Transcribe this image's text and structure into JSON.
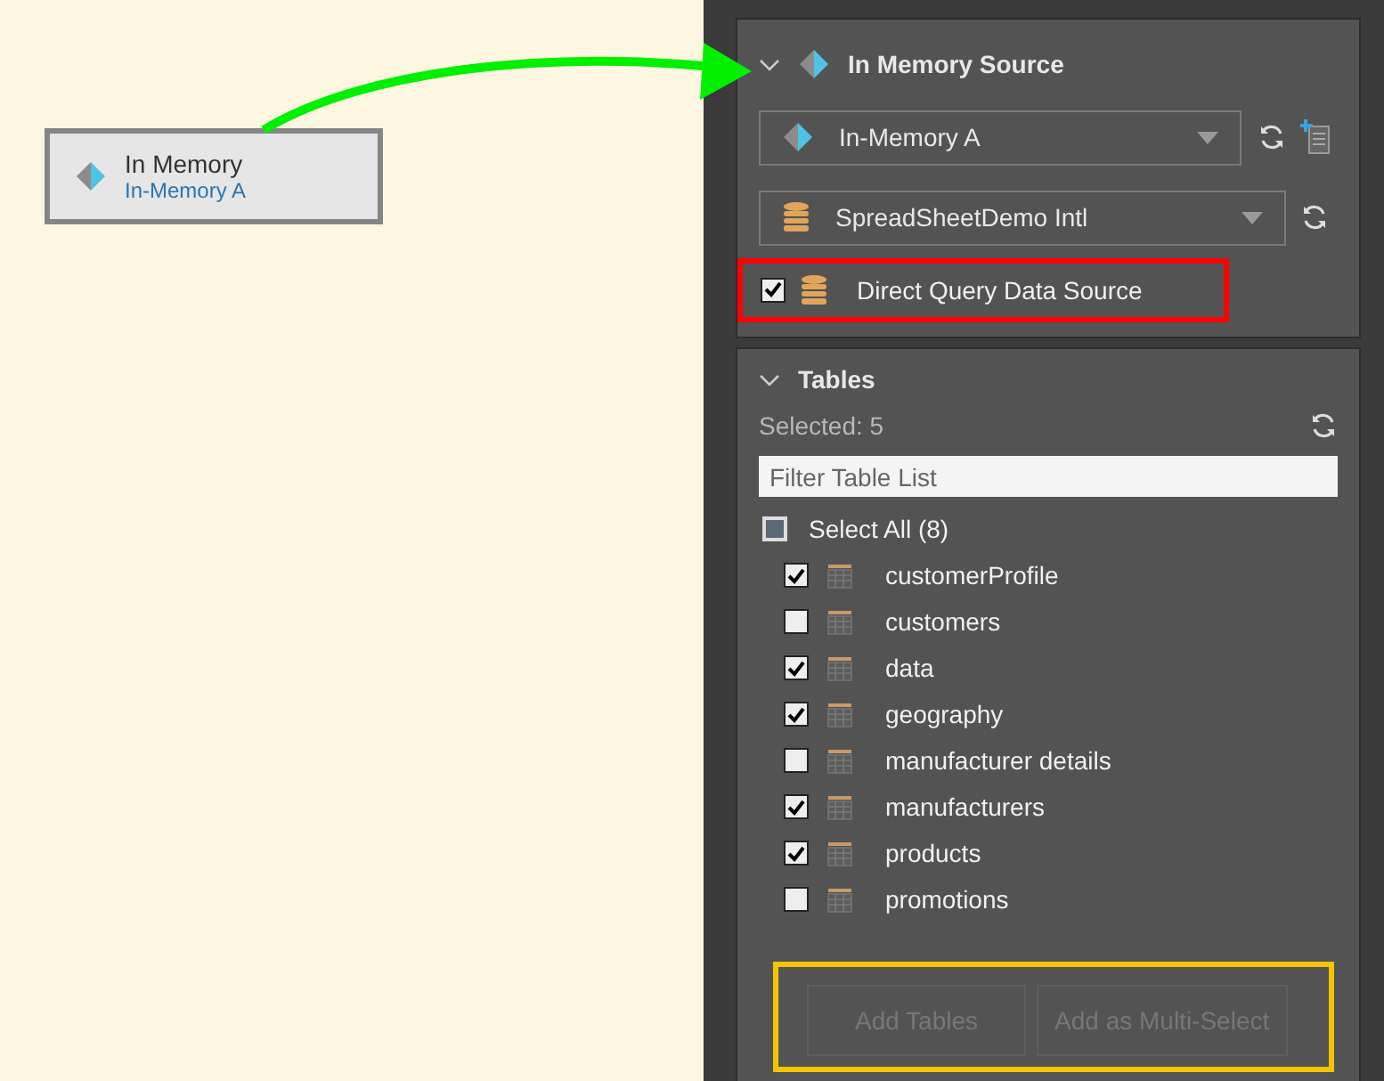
{
  "canvas": {
    "node": {
      "title": "In Memory",
      "subtitle": "In-Memory A"
    }
  },
  "source_section": {
    "title": "In Memory Source",
    "expanded": true,
    "connection": {
      "value": "In-Memory A"
    },
    "database": {
      "value": "SpreadSheetDemo Intl"
    },
    "direct_query": {
      "label": "Direct Query Data Source",
      "checked": true
    }
  },
  "tables_section": {
    "title": "Tables",
    "expanded": true,
    "selected_count": "Selected: 5",
    "filter": {
      "placeholder": "Filter Table List"
    },
    "select_all": {
      "label": "Select All (8)",
      "indeterminate": true
    },
    "tables": [
      {
        "name": "customerProfile",
        "checked": true
      },
      {
        "name": "customers",
        "checked": false
      },
      {
        "name": "data",
        "checked": true
      },
      {
        "name": "geography",
        "checked": true
      },
      {
        "name": "manufacturer details",
        "checked": false
      },
      {
        "name": "manufacturers",
        "checked": true
      },
      {
        "name": "products",
        "checked": true
      },
      {
        "name": "promotions",
        "checked": false
      }
    ],
    "buttons": [
      {
        "label": "Add Tables",
        "disabled": true
      },
      {
        "label": "Add as Multi-Select",
        "disabled": true
      }
    ]
  }
}
